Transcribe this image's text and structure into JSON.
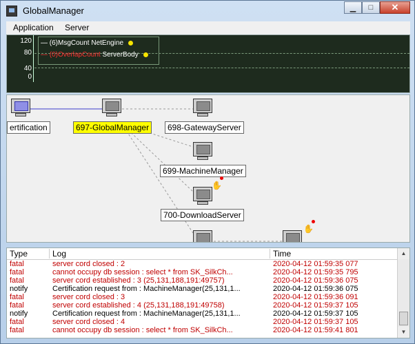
{
  "window": {
    "title": "GlobalManager"
  },
  "menu": {
    "items": [
      "Application",
      "Server"
    ]
  },
  "graph": {
    "y_ticks": [
      "120",
      "80",
      "40",
      "0"
    ],
    "legend": [
      {
        "label": "(6)MsgCount",
        "target": "NetEngine",
        "color": "#ffffff"
      },
      {
        "label": "(0)OverlapCount",
        "target": "ServerBody",
        "color": "#ff3030"
      }
    ]
  },
  "diagram": {
    "nodes": [
      {
        "label": "ertification",
        "selected": false,
        "monitor": "blue"
      },
      {
        "label": "697-GlobalManager",
        "selected": true,
        "monitor": "gray"
      },
      {
        "label": "698-GatewayServer",
        "selected": false,
        "monitor": "gray"
      },
      {
        "label": "699-MachineManager",
        "selected": false,
        "monitor": "gray"
      },
      {
        "label": "700-DownloadServer",
        "selected": false,
        "monitor": "gray",
        "alert": true
      },
      {
        "label": "",
        "selected": false,
        "monitor": "gray"
      },
      {
        "label": "",
        "selected": false,
        "monitor": "gray",
        "alert": true
      }
    ]
  },
  "log": {
    "columns": [
      "Type",
      "Log",
      "Time"
    ],
    "rows": [
      {
        "type": "fatal",
        "log": "server cord closed : 2",
        "time": "2020-04-12 01:59:35 077",
        "color": "#c00000"
      },
      {
        "type": "fatal",
        "log": "cannot occupy db session : select * from SK_SilkCh...",
        "time": "2020-04-12 01:59:35 795",
        "color": "#c00000"
      },
      {
        "type": "fatal",
        "log": "server cord established : 3 (25,131,188,191:49757)",
        "time": "2020-04-12 01:59:36 075",
        "color": "#c00000"
      },
      {
        "type": "notify",
        "log": "Certification request from : MachineManager(25,131,1...",
        "time": "2020-04-12 01:59:36 075",
        "color": "#000000"
      },
      {
        "type": "fatal",
        "log": "server cord closed : 3",
        "time": "2020-04-12 01:59:36 091",
        "color": "#c00000"
      },
      {
        "type": "fatal",
        "log": "server cord established : 4 (25,131,188,191:49758)",
        "time": "2020-04-12 01:59:37 105",
        "color": "#c00000"
      },
      {
        "type": "notify",
        "log": "Certification request from : MachineManager(25,131,1...",
        "time": "2020-04-12 01:59:37 105",
        "color": "#000000"
      },
      {
        "type": "fatal",
        "log": "server cord closed : 4",
        "time": "2020-04-12 01:59:37 105",
        "color": "#c00000"
      },
      {
        "type": "fatal",
        "log": "cannot occupy db session : select * from SK_SilkCh...",
        "time": "2020-04-12 01:59:41 801",
        "color": "#c00000"
      }
    ]
  }
}
